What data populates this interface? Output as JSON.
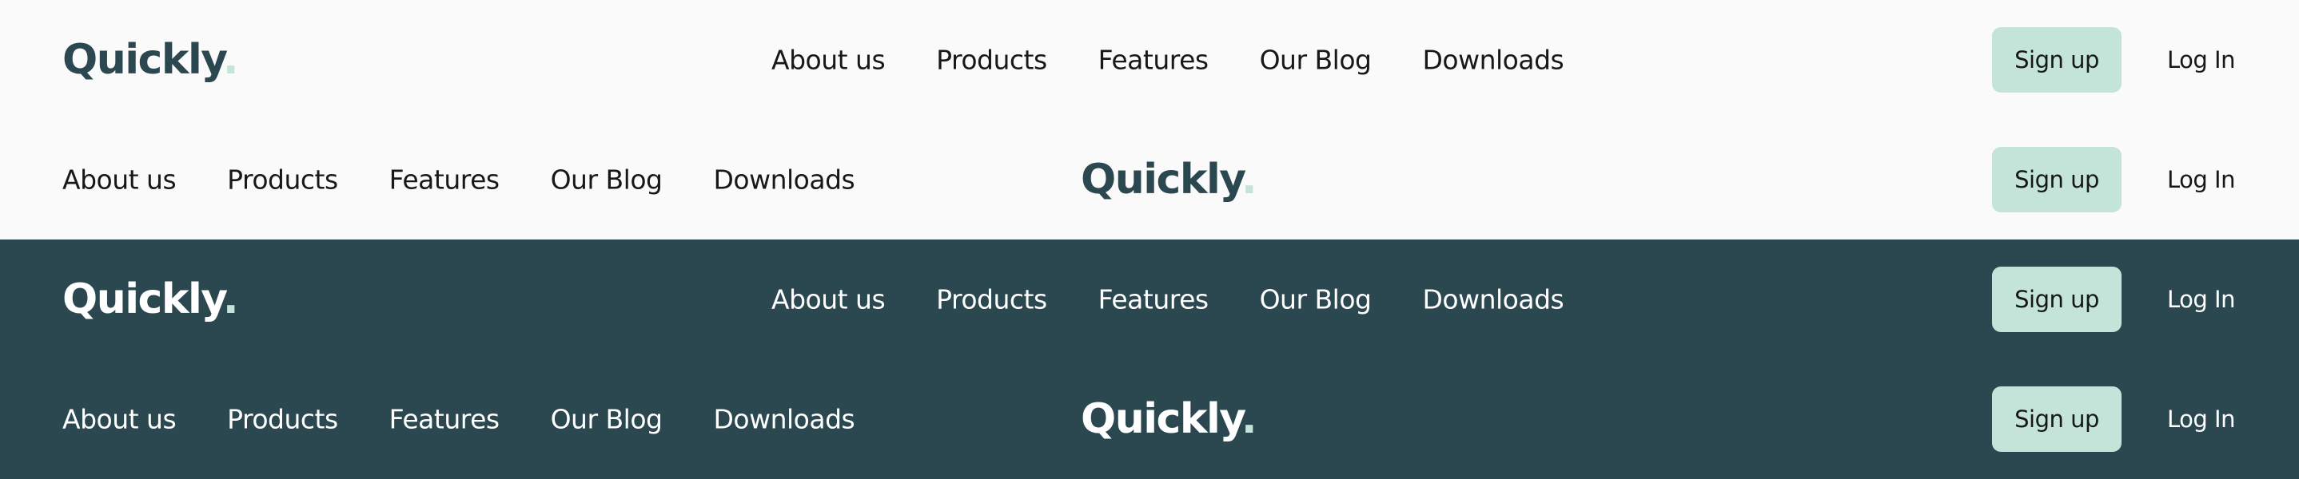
{
  "logo": {
    "word": "Quickly",
    "dot": "."
  },
  "nav": [
    "About us",
    "Products",
    "Features",
    "Our Blog",
    "Downloads"
  ],
  "actions": {
    "signup": "Sign up",
    "login": "Log In"
  },
  "colors": {
    "light_background": "#fafafa",
    "dark_background": "#2b4850",
    "accent": "#c4e4da",
    "brand_text": "#2b4850"
  }
}
